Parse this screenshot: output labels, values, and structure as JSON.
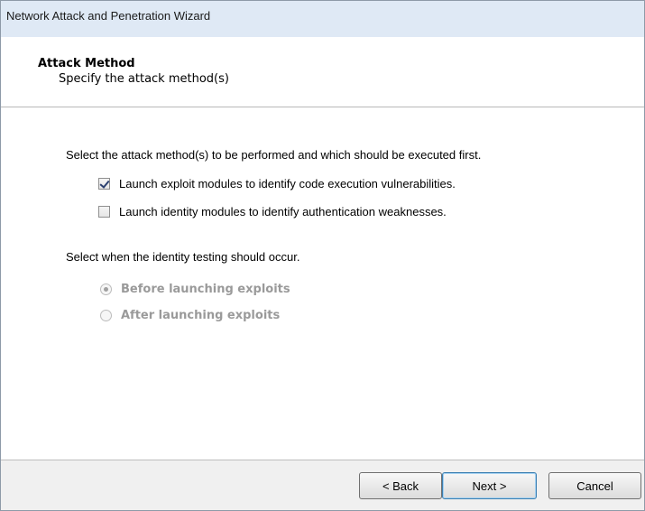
{
  "window": {
    "title": "Network Attack and Penetration Wizard"
  },
  "header": {
    "title": "Attack Method",
    "subtitle": "Specify the attack method(s)"
  },
  "body": {
    "instruction_methods": "Select the attack method(s) to be performed and which should be executed first.",
    "options": [
      {
        "label": "Launch exploit modules to identify code execution vulnerabilities.",
        "checked": true
      },
      {
        "label": "Launch identity modules to identify authentication weaknesses.",
        "checked": false
      }
    ],
    "instruction_timing": "Select when the identity testing should occur.",
    "timing_options": [
      {
        "label": "Before launching exploits",
        "selected": true,
        "disabled": true
      },
      {
        "label": "After launching exploits",
        "selected": false,
        "disabled": true
      }
    ]
  },
  "buttons": {
    "back": "< Back",
    "next": "Next >",
    "cancel": "Cancel"
  },
  "colors": {
    "titlebar_bg": "#dfe9f5",
    "disabled_text": "#9a9a9a"
  }
}
